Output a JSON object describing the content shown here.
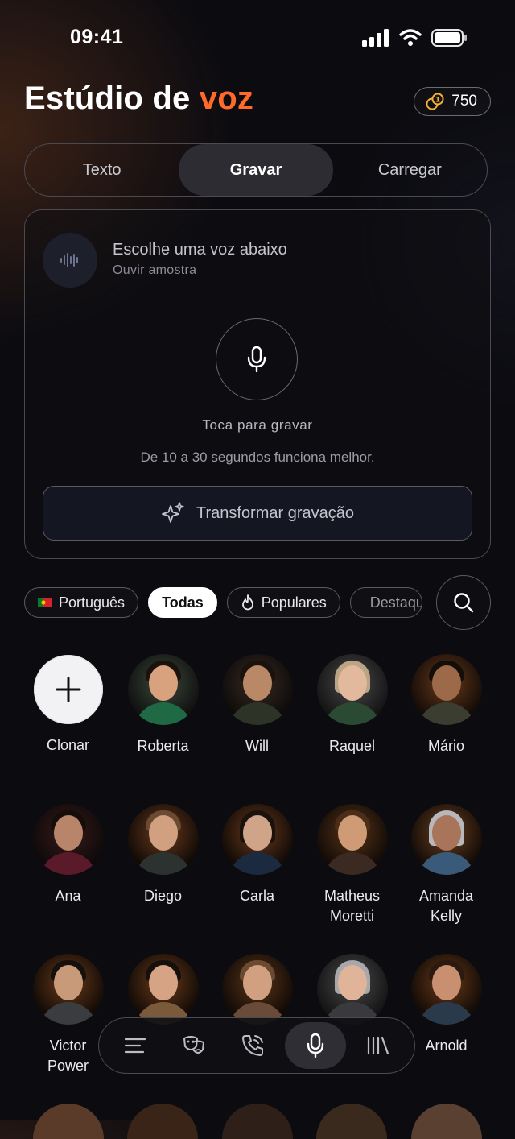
{
  "status": {
    "time": "09:41"
  },
  "header": {
    "title_main": "Estúdio de ",
    "title_accent": "voz",
    "credits": "750"
  },
  "tabs": [
    {
      "label": "Texto",
      "active": false
    },
    {
      "label": "Gravar",
      "active": true
    },
    {
      "label": "Carregar",
      "active": false
    }
  ],
  "recorder": {
    "voice_title": "Escolhe uma voz abaixo",
    "voice_subtitle": "Ouvir amostra",
    "tap_label": "Toca para gravar",
    "hint": "De 10 a 30 segundos funciona melhor.",
    "transform_label": "Transformar gravação"
  },
  "filters": {
    "language": "Português",
    "all": "Todas",
    "popular": "Populares",
    "featured": "Destaques"
  },
  "voices": [
    {
      "name": "Clonar"
    },
    {
      "name": "Roberta"
    },
    {
      "name": "Will"
    },
    {
      "name": "Raquel"
    },
    {
      "name": "Mário"
    },
    {
      "name": "Ana"
    },
    {
      "name": "Diego"
    },
    {
      "name": "Carla"
    },
    {
      "name": "Matheus Moretti"
    },
    {
      "name": "Amanda Kelly"
    },
    {
      "name": "Victor Power"
    },
    {
      "name": "Arnold"
    }
  ],
  "colors": {
    "accent": "#ff6a2b",
    "background": "#0b0b10"
  },
  "nav": {
    "items": [
      "menu-icon",
      "masks-icon",
      "phone-icon",
      "mic-icon",
      "library-icon"
    ],
    "active": "mic-icon"
  }
}
